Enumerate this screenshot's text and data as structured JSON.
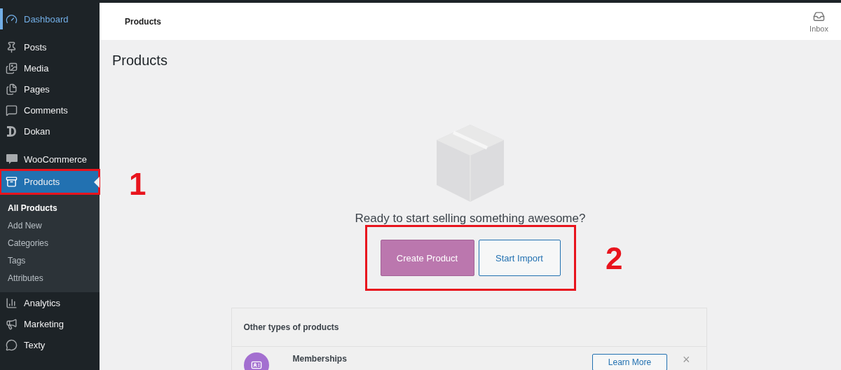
{
  "sidebar": {
    "groups": [
      [
        {
          "label": "Dashboard",
          "hover": true,
          "selected": false
        }
      ],
      [
        {
          "label": "Posts",
          "hover": false,
          "selected": false
        },
        {
          "label": "Media",
          "hover": false,
          "selected": false
        },
        {
          "label": "Pages",
          "hover": false,
          "selected": false
        },
        {
          "label": "Comments",
          "hover": false,
          "selected": false
        },
        {
          "label": "Dokan",
          "hover": false,
          "selected": false
        }
      ],
      [
        {
          "label": "WooCommerce",
          "hover": false,
          "selected": false
        },
        {
          "label": "Products",
          "hover": false,
          "selected": true,
          "outlined": true,
          "children": [
            {
              "label": "All Products",
              "selected": true
            },
            {
              "label": "Add New",
              "selected": false
            },
            {
              "label": "Categories",
              "selected": false
            },
            {
              "label": "Tags",
              "selected": false
            },
            {
              "label": "Attributes",
              "selected": false
            }
          ]
        },
        {
          "label": "Analytics",
          "hover": false,
          "selected": false
        },
        {
          "label": "Marketing",
          "hover": false,
          "selected": false
        },
        {
          "label": "Texty",
          "hover": false,
          "selected": false
        }
      ]
    ]
  },
  "header": {
    "title": "Products",
    "inbox": "Inbox"
  },
  "page_title": "Products",
  "empty_state": {
    "message": "Ready to start selling something awesome?",
    "outlined": true,
    "buttons": [
      {
        "label": "Create Product",
        "kind": "primary"
      },
      {
        "label": "Start Import",
        "kind": "secondary"
      }
    ]
  },
  "other_types": {
    "title": "Other types of products",
    "items": [
      {
        "name": "Memberships",
        "button": "Learn More",
        "dismiss": "×"
      }
    ]
  },
  "callouts": [
    {
      "label": "1"
    },
    {
      "label": "2"
    }
  ]
}
